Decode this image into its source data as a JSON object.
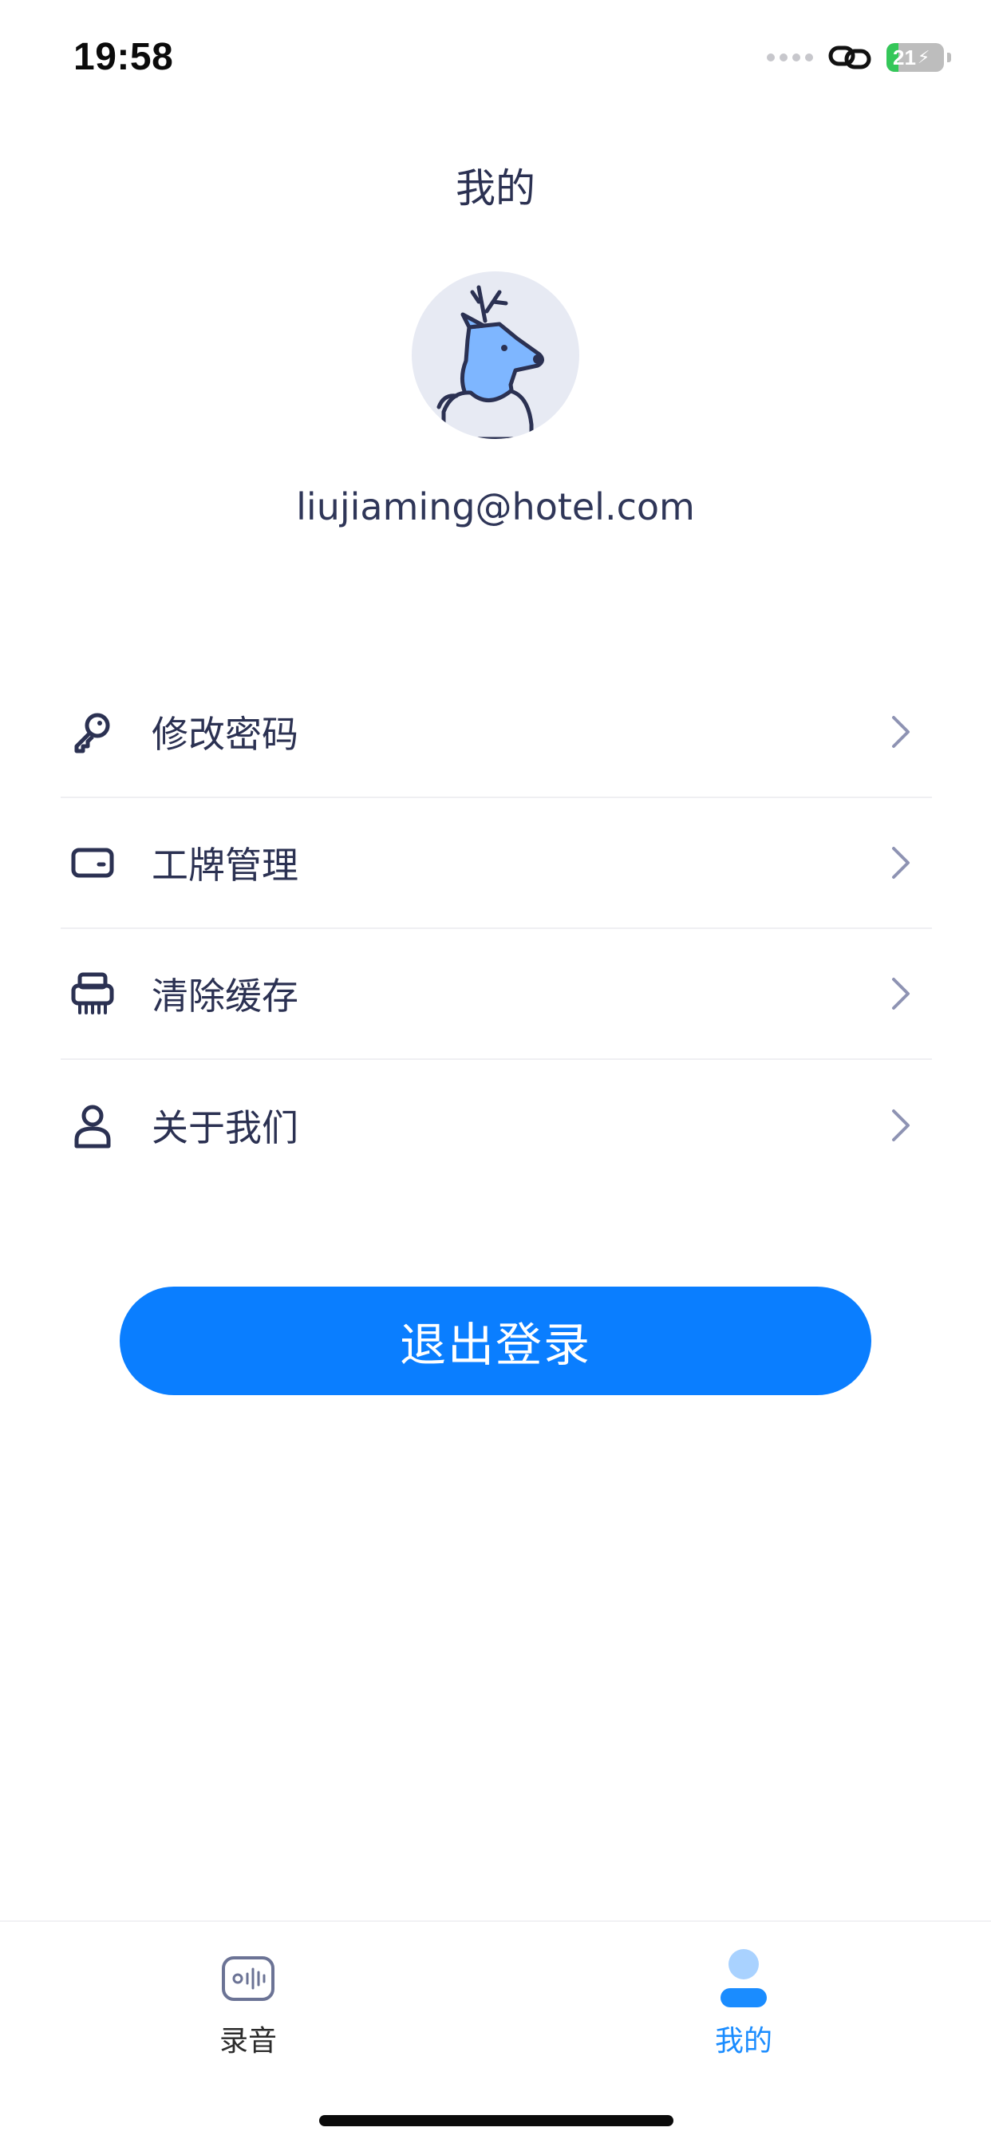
{
  "status_bar": {
    "time": "19:58",
    "battery_level": "21",
    "battery_fraction": 0.21,
    "icons": [
      "signal-dots-icon",
      "link-icon",
      "battery-charging-icon"
    ]
  },
  "header": {
    "title": "我的"
  },
  "profile": {
    "avatar_icon": "deer-avatar-icon",
    "email": "liujiaming@hotel.com"
  },
  "menu": {
    "items": [
      {
        "label": "修改密码",
        "icon": "key-icon"
      },
      {
        "label": "工牌管理",
        "icon": "wallet-icon"
      },
      {
        "label": "清除缓存",
        "icon": "shredder-icon"
      },
      {
        "label": "关于我们",
        "icon": "user-icon"
      }
    ],
    "chevron_icon": "chevron-right-icon"
  },
  "actions": {
    "logout_label": "退出登录"
  },
  "tab_bar": {
    "tabs": [
      {
        "label": "录音",
        "icon": "recording-icon",
        "active": false
      },
      {
        "label": "我的",
        "icon": "profile-icon",
        "active": true
      }
    ]
  },
  "colors": {
    "accent": "#0a7eff",
    "active_tab": "#1a8cff",
    "text_primary": "#2b3152",
    "chevron": "#8e93b3",
    "avatar_bg": "#e7eaf3",
    "deer": "#7eb6ff",
    "battery_fill": "#34c759"
  }
}
